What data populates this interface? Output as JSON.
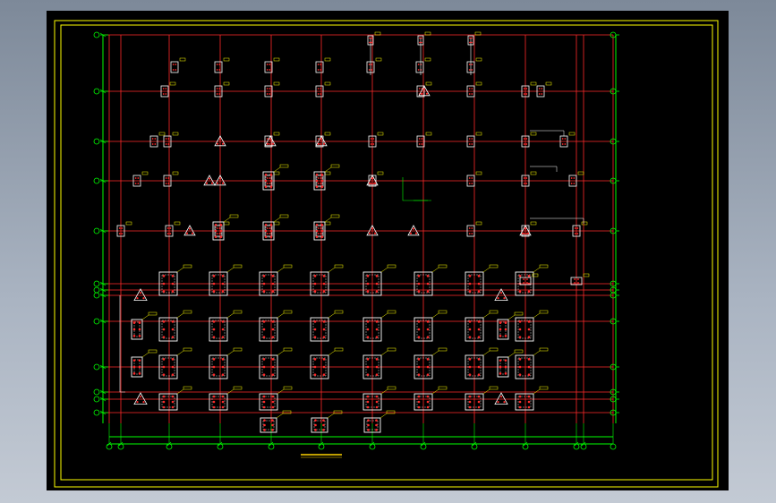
{
  "viewer": {
    "background": "#000000",
    "colors": {
      "frame": "#ffff00",
      "axis_grid": "#ff2a2a",
      "dimension": "#00ff00",
      "members": "#ffffff",
      "rebar": "#ff2a2a",
      "labels": "#ffff00",
      "title": "#ffd400"
    }
  },
  "plan": {
    "title": "",
    "icon": "foundation-plan"
  }
}
